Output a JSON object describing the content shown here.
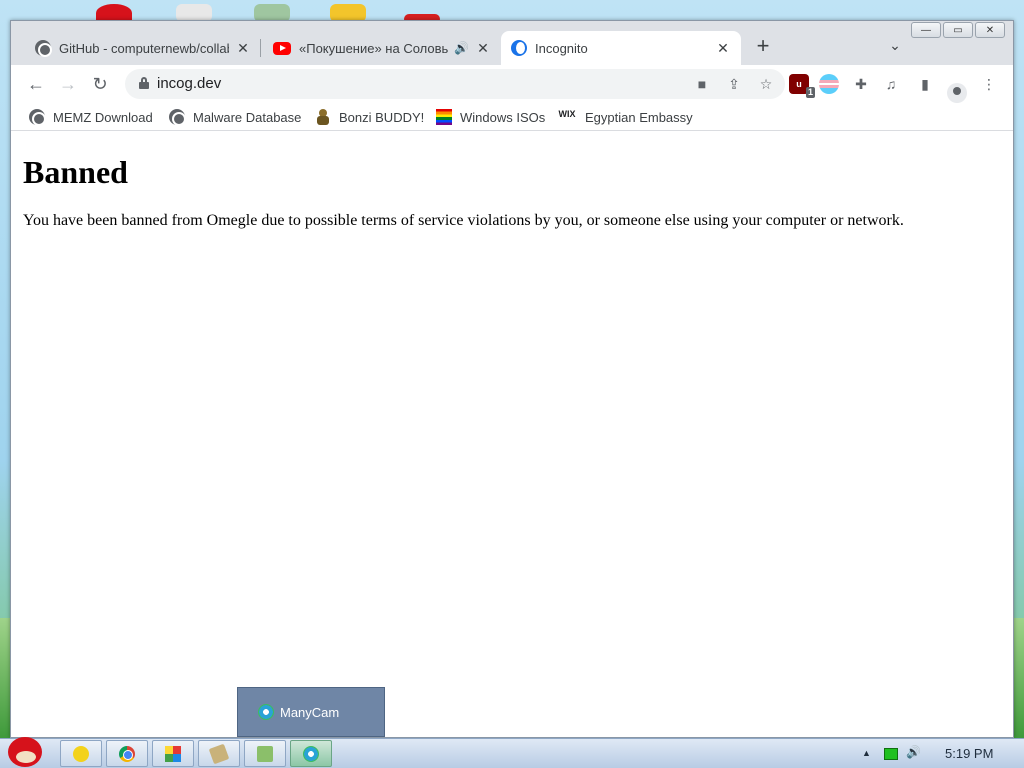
{
  "browser": {
    "tabs": [
      {
        "title": "GitHub - computernewb/collab",
        "icon": "github-globe-icon"
      },
      {
        "title": "«Покушение» на Соловьёва",
        "icon": "youtube-icon",
        "audio": "🔊"
      },
      {
        "title": "Incognito",
        "icon": "incognito-site-icon",
        "active": true
      }
    ],
    "close_glyph": "✕",
    "new_tab_glyph": "+",
    "tab_search_glyph": "⌄",
    "window_controls": {
      "minimize": "—",
      "maximize": "▭",
      "close": "✕"
    },
    "nav": {
      "back": "←",
      "forward": "→",
      "reload": "↻"
    },
    "url": "incog.dev",
    "ublock_badge": "1",
    "menu_glyph": "⋮"
  },
  "bookmarks": [
    {
      "label": "MEMZ Download",
      "icon": "globe-icon"
    },
    {
      "label": "Malware Database",
      "icon": "globe-icon"
    },
    {
      "label": "Bonzi BUDDY!",
      "icon": "bonzi-icon"
    },
    {
      "label": "Windows ISOs",
      "icon": "rainbow-flag-icon"
    },
    {
      "label": "Egyptian Embassy",
      "icon": "wix-icon",
      "icon_text": "WIX"
    }
  ],
  "page": {
    "heading": "Banned",
    "message": "You have been banned from Omegle due to possible terms of service violations by you, or someone else using your computer or network."
  },
  "popup": {
    "label": "ManyCam"
  },
  "taskbar": {
    "clock": "5:19 PM",
    "tray_arrow": "▲",
    "volume": "🔊"
  }
}
